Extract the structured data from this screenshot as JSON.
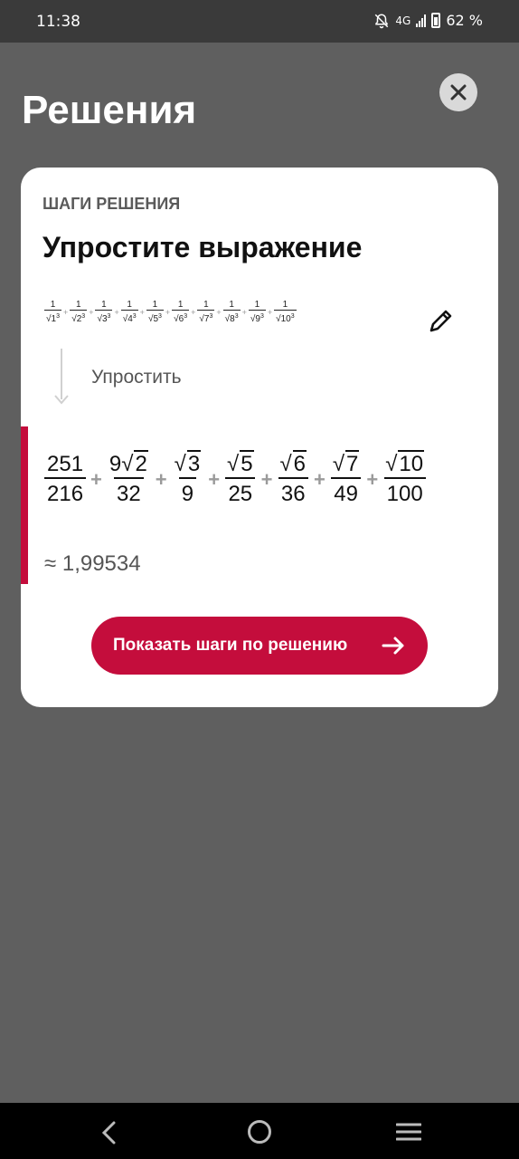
{
  "status": {
    "time": "11:38",
    "network": "4G",
    "battery": "62 %"
  },
  "header": {
    "title": "Решения"
  },
  "card": {
    "steps_label": "ШАГИ РЕШЕНИЯ",
    "title": "Упростите выражение",
    "problem_terms": [
      {
        "num": "1",
        "base": "1",
        "exp": "3"
      },
      {
        "num": "1",
        "base": "2",
        "exp": "3"
      },
      {
        "num": "1",
        "base": "3",
        "exp": "3"
      },
      {
        "num": "1",
        "base": "4",
        "exp": "3"
      },
      {
        "num": "1",
        "base": "5",
        "exp": "3"
      },
      {
        "num": "1",
        "base": "6",
        "exp": "3"
      },
      {
        "num": "1",
        "base": "7",
        "exp": "3"
      },
      {
        "num": "1",
        "base": "8",
        "exp": "3"
      },
      {
        "num": "1",
        "base": "9",
        "exp": "3"
      },
      {
        "num": "1",
        "base": "10",
        "exp": "3"
      }
    ],
    "step_label": "Упростить",
    "result_terms": [
      {
        "coef": "",
        "rad": "",
        "plain": "251",
        "den": "216"
      },
      {
        "coef": "9",
        "rad": "2",
        "plain": "",
        "den": "32"
      },
      {
        "coef": "",
        "rad": "3",
        "plain": "",
        "den": "9"
      },
      {
        "coef": "",
        "rad": "5",
        "plain": "",
        "den": "25"
      },
      {
        "coef": "",
        "rad": "6",
        "plain": "",
        "den": "36"
      },
      {
        "coef": "",
        "rad": "7",
        "plain": "",
        "den": "49"
      },
      {
        "coef": "",
        "rad": "10",
        "plain": "",
        "den": "100"
      }
    ],
    "plus_sign": "+",
    "approx": "≈ 1,99534",
    "button_label": "Показать шаги по решению"
  },
  "icons": {
    "close": "close-icon",
    "edit": "pencil-icon",
    "cta_arrow": "arrow-right-icon",
    "nav_back": "back-icon",
    "nav_home": "home-icon",
    "nav_menu": "menu-icon"
  },
  "colors": {
    "accent": "#c40d3c",
    "overlay": "#5f5f5f",
    "card": "#ffffff"
  }
}
